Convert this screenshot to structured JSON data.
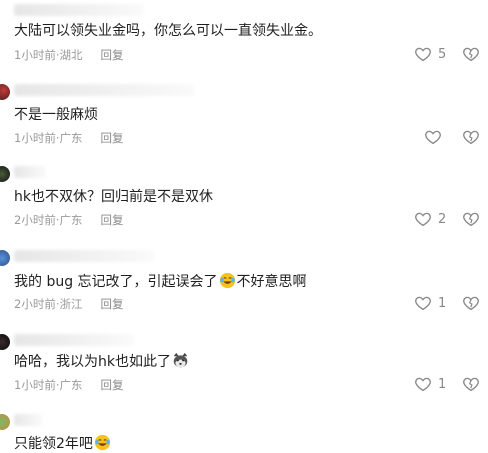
{
  "comments": [
    {
      "text": "大陆可以领失业金吗，你怎么可以一直领失业金。",
      "time": "1小时前",
      "location": "湖北",
      "reply": "回复",
      "likes": "5"
    },
    {
      "text": "不是一般麻烦",
      "time": "1小时前",
      "location": "广东",
      "reply": "回复",
      "likes": ""
    },
    {
      "text": "hk也不双休？回归前是不是双休",
      "time": "2小时前",
      "location": "广东",
      "reply": "回复",
      "likes": "2"
    },
    {
      "text_before": "我的 bug 忘记改了，引起误会了",
      "text_after": "不好意思啊",
      "time": "2小时前",
      "location": "浙江",
      "reply": "回复",
      "likes": "1",
      "emoji": "laughing-crying-emoji"
    },
    {
      "text": "哈哈，我以为hk也如此了",
      "time": "1小时前",
      "location": "广东",
      "reply": "回复",
      "likes": "1",
      "emoji": "husky-emoji"
    },
    {
      "text": "只能领2年吧",
      "emoji": "laughing-crying-emoji"
    }
  ],
  "meta_separator": " · ",
  "colors": {
    "meta": "#9a9a9a",
    "icon": "#888888",
    "text": "#1f1f1f"
  }
}
